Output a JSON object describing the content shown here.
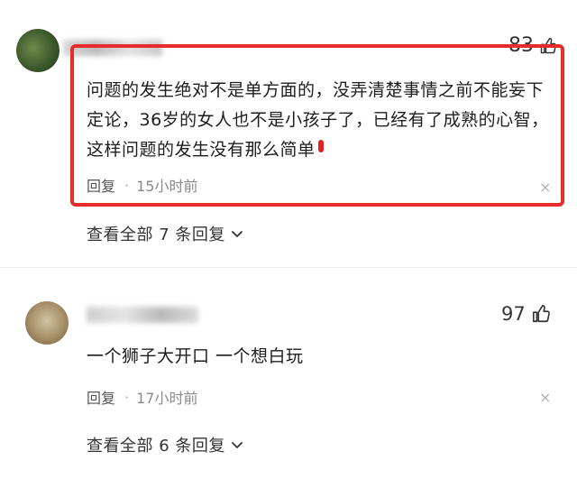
{
  "comments": [
    {
      "text": "问题的发生绝对不是单方面的，没弄清楚事情之前不能妄下定论，36岁的女人也不是小孩子了，已经有了成熟的心智，这样问题的发生没有那么简单",
      "likes": "83",
      "reply_label": "回复",
      "separator": "·",
      "time": "15小时前",
      "close_glyph": "×",
      "view_all": "查看全部 7 条回复",
      "highlighted": true,
      "highlight_color": "#e82c2c"
    },
    {
      "text": "一个狮子大开口 一个想白玩",
      "likes": "97",
      "reply_label": "回复",
      "separator": "·",
      "time": "17小时前",
      "close_glyph": "×",
      "view_all": "查看全部 6 条回复",
      "highlighted": false
    }
  ],
  "icons": {
    "like": "thumbs-up-icon",
    "expand": "chevron-down-icon",
    "close": "close-icon",
    "emphasis": "red-exclamation-emoji"
  }
}
